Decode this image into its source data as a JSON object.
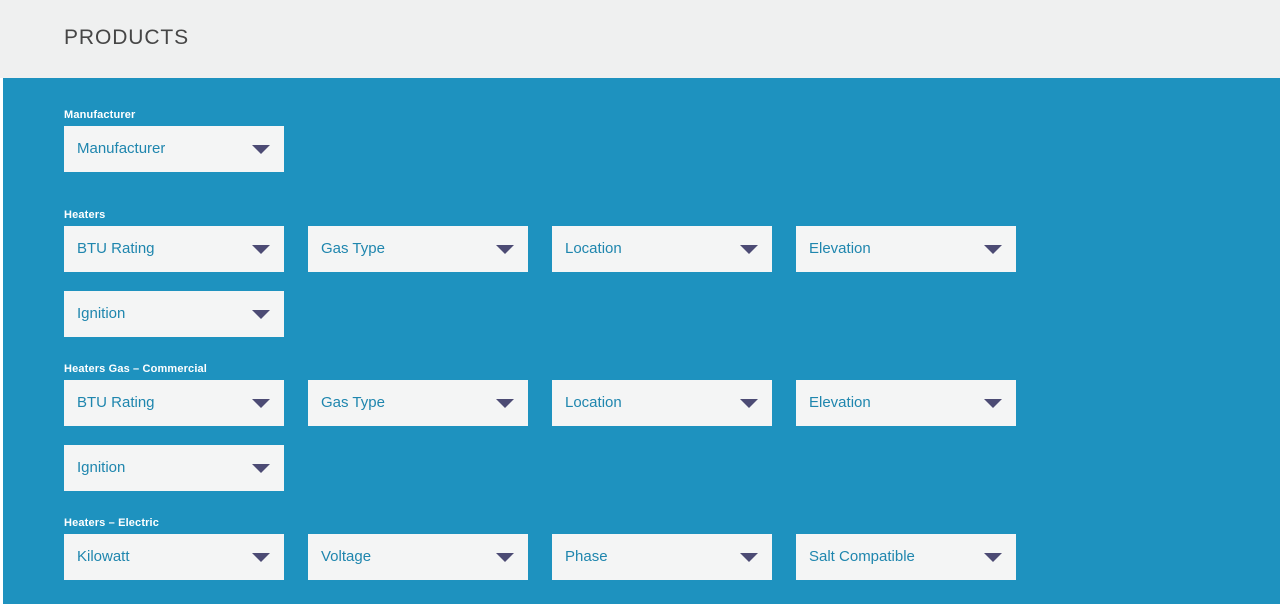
{
  "header": {
    "title": "PRODUCTS"
  },
  "colors": {
    "header_bg": "#eff0f0",
    "panel_bg": "#1e92bf",
    "select_bg": "#f4f5f5",
    "select_text": "#1f86ae",
    "arrow": "#4c4b74",
    "label_text": "#ffffff",
    "title_text": "#464646"
  },
  "groups": [
    {
      "label": "Manufacturer",
      "rows": [
        [
          {
            "name": "manufacturer",
            "value": "Manufacturer",
            "icon": "chevron-down-icon"
          }
        ]
      ]
    },
    {
      "label": "Heaters",
      "rows": [
        [
          {
            "name": "btu-rating",
            "value": "BTU Rating",
            "icon": "chevron-down-icon"
          },
          {
            "name": "gas-type",
            "value": "Gas Type",
            "icon": "chevron-down-icon"
          },
          {
            "name": "location",
            "value": "Location",
            "icon": "chevron-down-icon"
          },
          {
            "name": "elevation",
            "value": "Elevation",
            "icon": "chevron-down-icon"
          }
        ],
        [
          {
            "name": "ignition",
            "value": "Ignition",
            "icon": "chevron-down-icon"
          }
        ]
      ]
    },
    {
      "label": "Heaters Gas – Commercial",
      "rows": [
        [
          {
            "name": "btu-rating",
            "value": "BTU Rating",
            "icon": "chevron-down-icon"
          },
          {
            "name": "gas-type",
            "value": "Gas Type",
            "icon": "chevron-down-icon"
          },
          {
            "name": "location",
            "value": "Location",
            "icon": "chevron-down-icon"
          },
          {
            "name": "elevation",
            "value": "Elevation",
            "icon": "chevron-down-icon"
          }
        ],
        [
          {
            "name": "ignition",
            "value": "Ignition",
            "icon": "chevron-down-icon"
          }
        ]
      ]
    },
    {
      "label": "Heaters – Electric",
      "rows": [
        [
          {
            "name": "kilowatt",
            "value": "Kilowatt",
            "icon": "chevron-down-icon"
          },
          {
            "name": "voltage",
            "value": "Voltage",
            "icon": "chevron-down-icon"
          },
          {
            "name": "phase",
            "value": "Phase",
            "icon": "chevron-down-icon"
          },
          {
            "name": "salt-compatible",
            "value": "Salt Compatible",
            "icon": "chevron-down-icon"
          }
        ]
      ]
    }
  ]
}
